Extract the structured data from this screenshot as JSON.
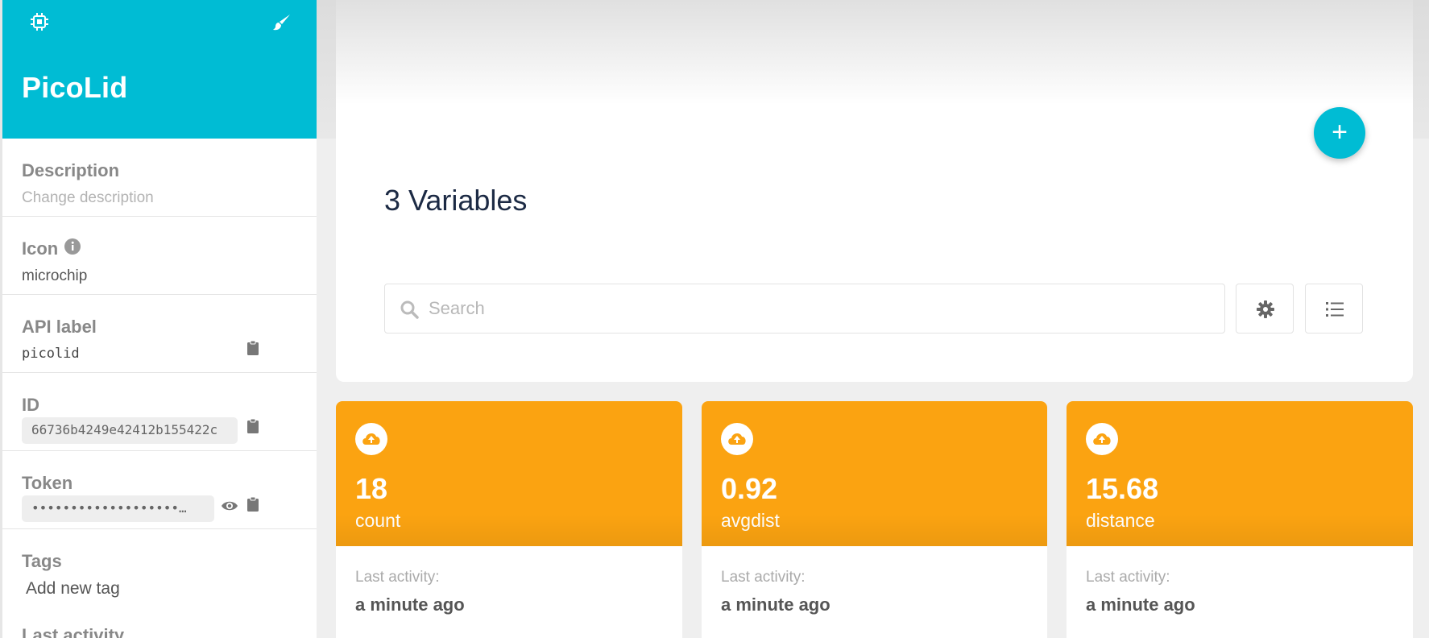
{
  "sidebar": {
    "device_name": "PicoLid",
    "description": {
      "label": "Description",
      "placeholder": "Change description"
    },
    "icon": {
      "label": "Icon",
      "value": "microchip"
    },
    "api_label": {
      "label": "API label",
      "value": "picolid"
    },
    "id": {
      "label": "ID",
      "value": "66736b4249e42412b155422c"
    },
    "token": {
      "label": "Token",
      "value": "•••••••••••••••••••…"
    },
    "tags": {
      "label": "Tags",
      "add_placeholder": "Add new tag"
    },
    "last_activity_label": "Last activity"
  },
  "main": {
    "title": "3 Variables",
    "add_button": "+",
    "search": {
      "placeholder": "Search"
    }
  },
  "variables": [
    {
      "value": "18",
      "name": "count",
      "activity_label": "Last activity:",
      "activity_value": "a minute ago"
    },
    {
      "value": "0.92",
      "name": "avgdist",
      "activity_label": "Last activity:",
      "activity_value": "a minute ago"
    },
    {
      "value": "15.68",
      "name": "distance",
      "activity_label": "Last activity:",
      "activity_value": "a minute ago"
    }
  ],
  "colors": {
    "accent": "#00bcd4",
    "variable_card": "#fba311",
    "title": "#1c2a44"
  },
  "icons": [
    "microchip-icon",
    "paint-brush-icon",
    "info-icon",
    "clipboard-icon",
    "eye-icon",
    "search-icon",
    "gear-icon",
    "list-icon",
    "cloud-upload-icon"
  ]
}
